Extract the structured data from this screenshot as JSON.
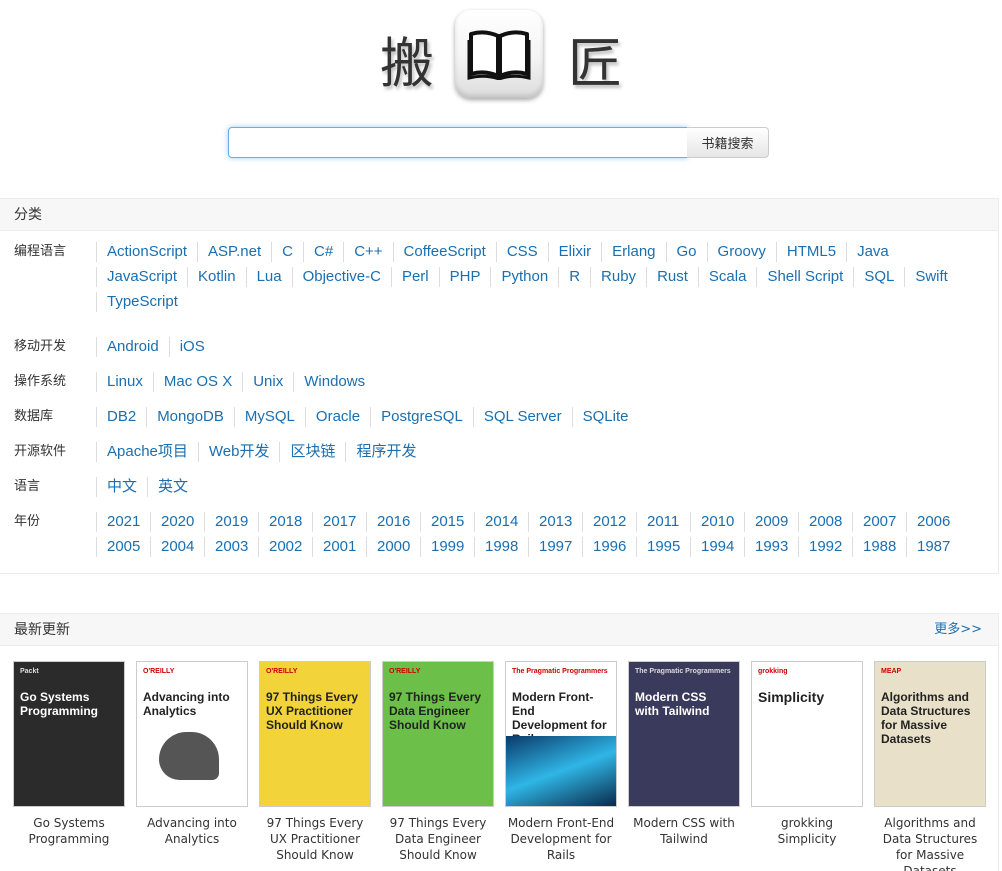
{
  "logo": {
    "left_char": "搬",
    "right_char": "匠"
  },
  "search": {
    "value": "",
    "button_label": "书籍搜索"
  },
  "categories": {
    "title": "分类",
    "rows": [
      {
        "label": "编程语言",
        "items": [
          "ActionScript",
          "ASP.net",
          "C",
          "C#",
          "C++",
          "CoffeeScript",
          "CSS",
          "Elixir",
          "Erlang",
          "Go",
          "Groovy",
          "HTML5",
          "Java",
          "JavaScript",
          "Kotlin",
          "Lua",
          "Objective-C",
          "Perl",
          "PHP",
          "Python",
          "R",
          "Ruby",
          "Rust",
          "Scala",
          "Shell Script",
          "SQL",
          "Swift",
          "TypeScript"
        ]
      },
      {
        "label": "移动开发",
        "items": [
          "Android",
          "iOS"
        ]
      },
      {
        "label": "操作系统",
        "items": [
          "Linux",
          "Mac OS X",
          "Unix",
          "Windows"
        ]
      },
      {
        "label": "数据库",
        "items": [
          "DB2",
          "MongoDB",
          "MySQL",
          "Oracle",
          "PostgreSQL",
          "SQL Server",
          "SQLite"
        ]
      },
      {
        "label": "开源软件",
        "items": [
          "Apache项目",
          "Web开发",
          "区块链",
          "程序开发"
        ]
      },
      {
        "label": "语言",
        "items": [
          "中文",
          "英文"
        ]
      },
      {
        "label": "年份",
        "items": [
          "2021",
          "2020",
          "2019",
          "2018",
          "2017",
          "2016",
          "2015",
          "2014",
          "2013",
          "2012",
          "2011",
          "2010",
          "2009",
          "2008",
          "2007",
          "2006",
          "2005",
          "2004",
          "2003",
          "2002",
          "2001",
          "2000",
          "1999",
          "1998",
          "1997",
          "1996",
          "1995",
          "1994",
          "1993",
          "1992",
          "1988",
          "1987"
        ]
      }
    ]
  },
  "latest": {
    "title": "最新更新",
    "more_label": "更多>>",
    "books": [
      {
        "title": "Go Systems Programming",
        "cover_text": "Go Systems Programming",
        "cover_publisher": "Packt",
        "cover_bg": "#2b2b2b"
      },
      {
        "title": "Advancing into Analytics",
        "cover_text": "Advancing into Analytics",
        "cover_publisher": "O'REILLY",
        "cover_bg": "#ffffff"
      },
      {
        "title": "97 Things Every UX Practitioner Should Know",
        "cover_text": "97 Things Every UX Practitioner Should Know",
        "cover_publisher": "O'REILLY",
        "cover_bg": "#f2d43a"
      },
      {
        "title": "97 Things Every Data Engineer Should Know",
        "cover_text": "97 Things Every Data Engineer Should Know",
        "cover_publisher": "O'REILLY",
        "cover_bg": "#6cc04a"
      },
      {
        "title": "Modern Front-End Development for Rails",
        "cover_text": "Modern Front-End Development for Rails",
        "cover_publisher": "The Pragmatic Programmers",
        "cover_bg": "#ffffff"
      },
      {
        "title": "Modern CSS with Tailwind",
        "cover_text": "Modern CSS with Tailwind",
        "cover_publisher": "The Pragmatic Programmers",
        "cover_bg": "#3a3a5c"
      },
      {
        "title": "grokking Simplicity",
        "cover_text": "Simplicity",
        "cover_publisher": "grokking",
        "cover_bg": "#ffffff"
      },
      {
        "title": "Algorithms and Data Structures for Massive Datasets",
        "cover_text": "Algorithms and Data Structures for Massive Datasets",
        "cover_publisher": "MEAP",
        "cover_bg": "#e8e0c8"
      }
    ]
  }
}
